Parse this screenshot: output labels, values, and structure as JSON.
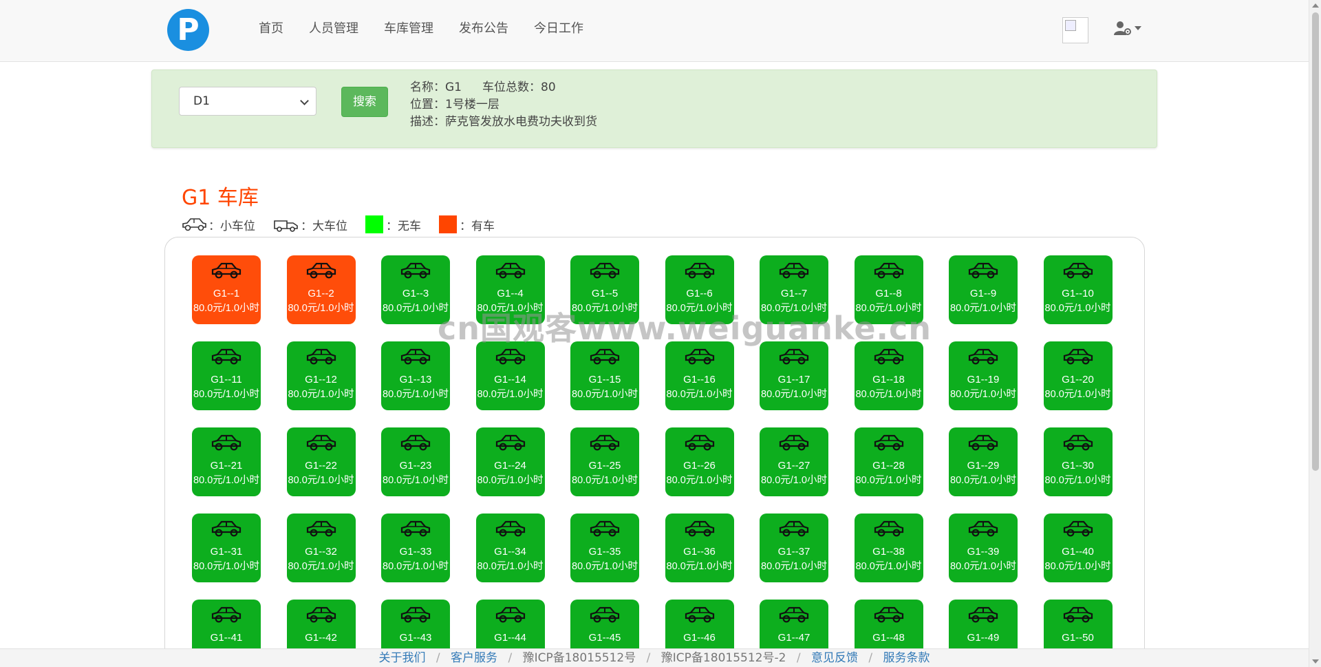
{
  "nav": {
    "logo_letter": "P",
    "links": [
      "首页",
      "人员管理",
      "车库管理",
      "发布公告",
      "今日工作"
    ]
  },
  "search": {
    "selected_garage": "D1",
    "button_label": "搜索"
  },
  "info": {
    "name_label": "名称：",
    "name": "G1",
    "total_label": "车位总数：",
    "total": "80",
    "location_label": "位置：",
    "location": "1号楼一层",
    "desc_label": "描述：",
    "desc": "萨克管发放水电费功夫收到货"
  },
  "garage_title": "G1 车库",
  "legend": {
    "small": "：小车位",
    "large": "：大车位",
    "free": "：无车",
    "occupied": "：有车",
    "free_color": "#00ff00",
    "occupied_color": "#ff4500"
  },
  "colors": {
    "free_spot": "#0dae1e",
    "occupied_spot": "#ff4d0a",
    "brand": "#1a8fe0"
  },
  "spots": [
    {
      "code": "G1--1",
      "price": "80.0元/1.0小时",
      "status": "occupied"
    },
    {
      "code": "G1--2",
      "price": "80.0元/1.0小时",
      "status": "occupied"
    },
    {
      "code": "G1--3",
      "price": "80.0元/1.0小时",
      "status": "free"
    },
    {
      "code": "G1--4",
      "price": "80.0元/1.0小时",
      "status": "free"
    },
    {
      "code": "G1--5",
      "price": "80.0元/1.0小时",
      "status": "free"
    },
    {
      "code": "G1--6",
      "price": "80.0元/1.0小时",
      "status": "free"
    },
    {
      "code": "G1--7",
      "price": "80.0元/1.0小时",
      "status": "free"
    },
    {
      "code": "G1--8",
      "price": "80.0元/1.0小时",
      "status": "free"
    },
    {
      "code": "G1--9",
      "price": "80.0元/1.0小时",
      "status": "free"
    },
    {
      "code": "G1--10",
      "price": "80.0元/1.0小时",
      "status": "free"
    },
    {
      "code": "G1--11",
      "price": "80.0元/1.0小时",
      "status": "free"
    },
    {
      "code": "G1--12",
      "price": "80.0元/1.0小时",
      "status": "free"
    },
    {
      "code": "G1--13",
      "price": "80.0元/1.0小时",
      "status": "free"
    },
    {
      "code": "G1--14",
      "price": "80.0元/1.0小时",
      "status": "free"
    },
    {
      "code": "G1--15",
      "price": "80.0元/1.0小时",
      "status": "free"
    },
    {
      "code": "G1--16",
      "price": "80.0元/1.0小时",
      "status": "free"
    },
    {
      "code": "G1--17",
      "price": "80.0元/1.0小时",
      "status": "free"
    },
    {
      "code": "G1--18",
      "price": "80.0元/1.0小时",
      "status": "free"
    },
    {
      "code": "G1--19",
      "price": "80.0元/1.0小时",
      "status": "free"
    },
    {
      "code": "G1--20",
      "price": "80.0元/1.0小时",
      "status": "free"
    },
    {
      "code": "G1--21",
      "price": "80.0元/1.0小时",
      "status": "free"
    },
    {
      "code": "G1--22",
      "price": "80.0元/1.0小时",
      "status": "free"
    },
    {
      "code": "G1--23",
      "price": "80.0元/1.0小时",
      "status": "free"
    },
    {
      "code": "G1--24",
      "price": "80.0元/1.0小时",
      "status": "free"
    },
    {
      "code": "G1--25",
      "price": "80.0元/1.0小时",
      "status": "free"
    },
    {
      "code": "G1--26",
      "price": "80.0元/1.0小时",
      "status": "free"
    },
    {
      "code": "G1--27",
      "price": "80.0元/1.0小时",
      "status": "free"
    },
    {
      "code": "G1--28",
      "price": "80.0元/1.0小时",
      "status": "free"
    },
    {
      "code": "G1--29",
      "price": "80.0元/1.0小时",
      "status": "free"
    },
    {
      "code": "G1--30",
      "price": "80.0元/1.0小时",
      "status": "free"
    },
    {
      "code": "G1--31",
      "price": "80.0元/1.0小时",
      "status": "free"
    },
    {
      "code": "G1--32",
      "price": "80.0元/1.0小时",
      "status": "free"
    },
    {
      "code": "G1--33",
      "price": "80.0元/1.0小时",
      "status": "free"
    },
    {
      "code": "G1--34",
      "price": "80.0元/1.0小时",
      "status": "free"
    },
    {
      "code": "G1--35",
      "price": "80.0元/1.0小时",
      "status": "free"
    },
    {
      "code": "G1--36",
      "price": "80.0元/1.0小时",
      "status": "free"
    },
    {
      "code": "G1--37",
      "price": "80.0元/1.0小时",
      "status": "free"
    },
    {
      "code": "G1--38",
      "price": "80.0元/1.0小时",
      "status": "free"
    },
    {
      "code": "G1--39",
      "price": "80.0元/1.0小时",
      "status": "free"
    },
    {
      "code": "G1--40",
      "price": "80.0元/1.0小时",
      "status": "free"
    },
    {
      "code": "G1--41",
      "price": "",
      "status": "free"
    },
    {
      "code": "G1--42",
      "price": "",
      "status": "free"
    },
    {
      "code": "G1--43",
      "price": "",
      "status": "free"
    },
    {
      "code": "G1--44",
      "price": "",
      "status": "free"
    },
    {
      "code": "G1--45",
      "price": "",
      "status": "free"
    },
    {
      "code": "G1--46",
      "price": "",
      "status": "free"
    },
    {
      "code": "G1--47",
      "price": "",
      "status": "free"
    },
    {
      "code": "G1--48",
      "price": "",
      "status": "free"
    },
    {
      "code": "G1--49",
      "price": "",
      "status": "free"
    },
    {
      "code": "G1--50",
      "price": "",
      "status": "free"
    }
  ],
  "watermark": "cn国观客www.weiguanke.cn",
  "footer": {
    "about": "关于我们",
    "service": "客户服务",
    "icp1": "豫ICP备18015512号",
    "icp2": "豫ICP备18015512号-2",
    "feedback": "意见反馈",
    "terms": "服务条款",
    "separator": "/"
  }
}
